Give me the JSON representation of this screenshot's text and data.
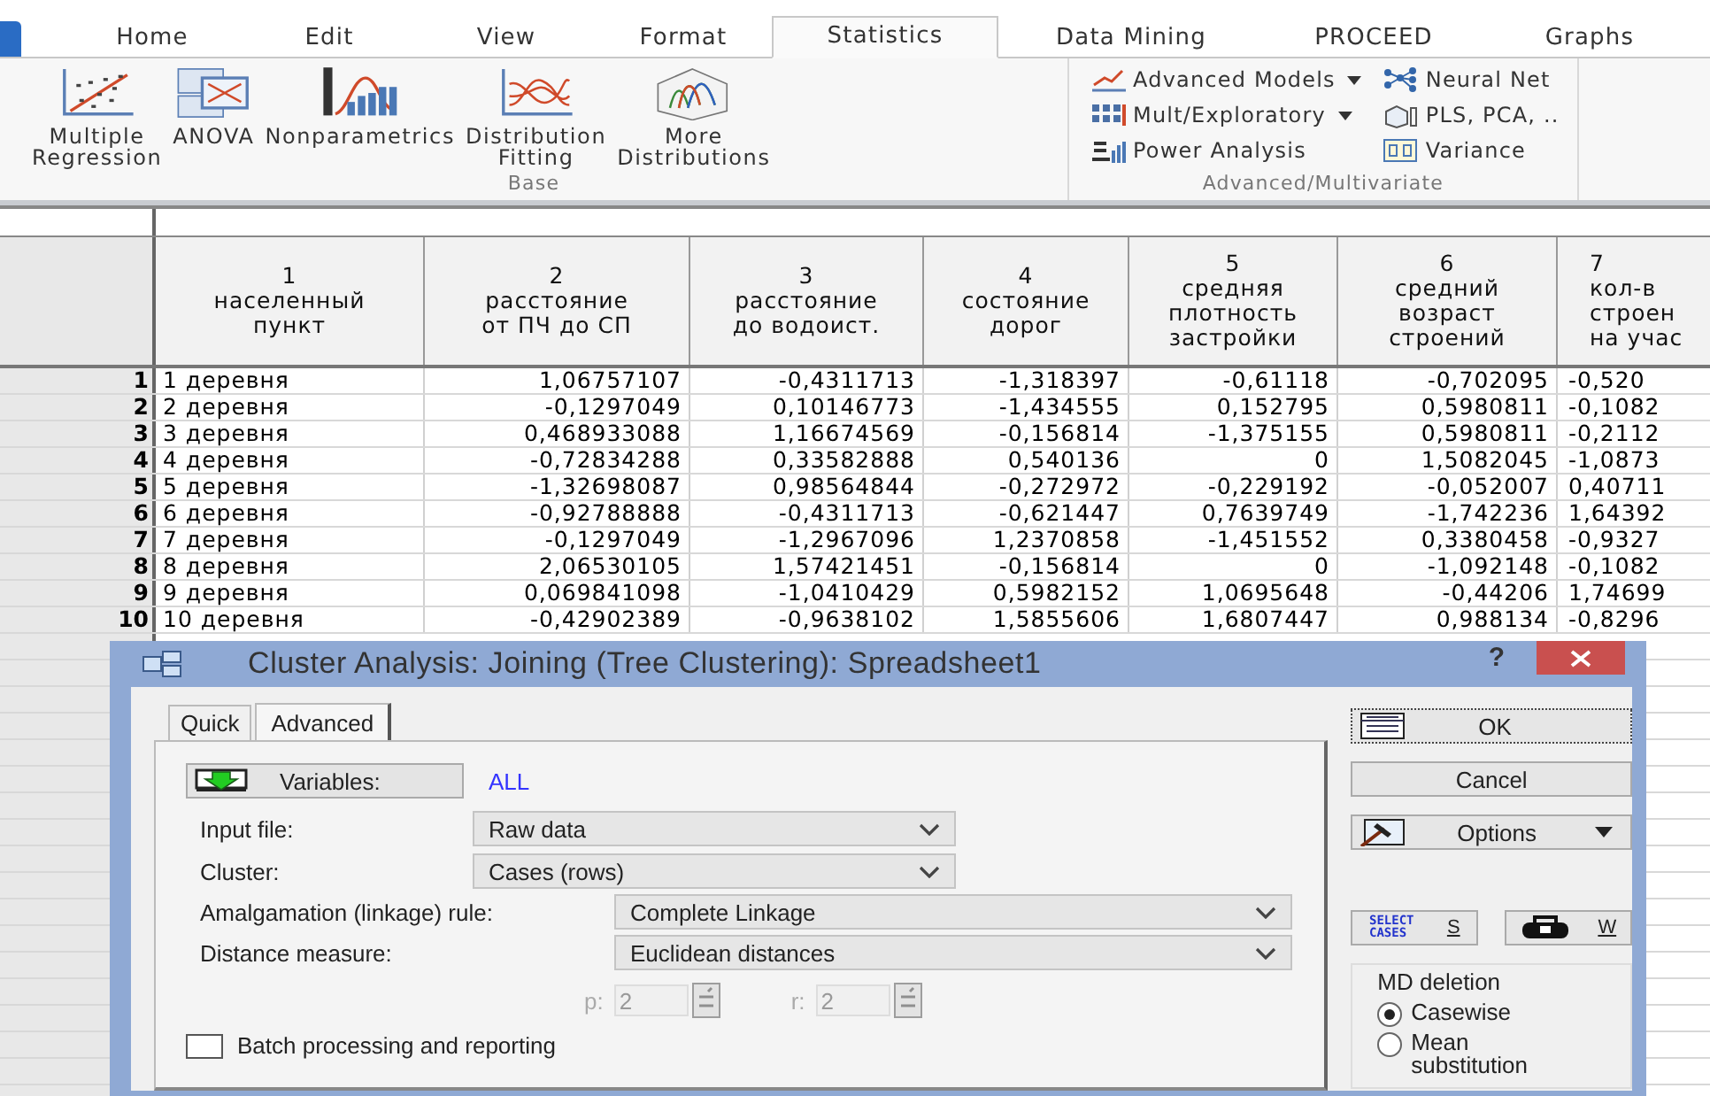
{
  "ribbon": {
    "tabs": [
      {
        "label": "Home",
        "selected": false
      },
      {
        "label": "Edit",
        "selected": false
      },
      {
        "label": "View",
        "selected": false
      },
      {
        "label": "Format",
        "selected": false
      },
      {
        "label": "Statistics",
        "selected": true
      },
      {
        "label": "Data Mining",
        "selected": false
      },
      {
        "label": "PROCEED",
        "selected": false
      },
      {
        "label": "Graphs",
        "selected": false
      }
    ],
    "groups": [
      {
        "label": "Base",
        "kind": "large",
        "items": [
          {
            "label": "Multiple\nRegression"
          },
          {
            "label": "ANOVA"
          },
          {
            "label": "Nonparametrics"
          },
          {
            "label": "Distribution\nFitting"
          },
          {
            "label": "More\nDistributions"
          }
        ]
      },
      {
        "label": "Advanced/Multivariate",
        "kind": "small",
        "items": [
          {
            "label": "Advanced Models",
            "has_menu": true
          },
          {
            "label": "Mult/Exploratory",
            "has_menu": true
          },
          {
            "label": "Power Analysis",
            "has_menu": false
          },
          {
            "label": "Neural Net",
            "has_menu": false
          },
          {
            "label": "PLS, PCA, ..",
            "has_menu": false
          },
          {
            "label": "Variance",
            "has_menu": false
          }
        ]
      }
    ]
  },
  "spreadsheet": {
    "columns": [
      {
        "number": "1",
        "name": "населенный\nпункт"
      },
      {
        "number": "2",
        "name": "расстояние\nот ПЧ до СП"
      },
      {
        "number": "3",
        "name": "расстояние\nдо водоист."
      },
      {
        "number": "4",
        "name": "состояние\nдорог"
      },
      {
        "number": "5",
        "name": "средняя\nплотность\nзастройки"
      },
      {
        "number": "6",
        "name": "средний\nвозраст\nстроений"
      },
      {
        "number": "7",
        "name": "кол-в\nстроен\nна учас"
      }
    ],
    "rows": [
      {
        "number": "1",
        "cells": [
          "1 деревня",
          "1,06757107",
          "-0,4311713",
          "-1,318397",
          "-0,61118",
          "-0,702095",
          "-0,520"
        ]
      },
      {
        "number": "2",
        "cells": [
          "2 деревня",
          "-0,1297049",
          "0,10146773",
          "-1,434555",
          "0,152795",
          "0,5980811",
          "-0,1082"
        ]
      },
      {
        "number": "3",
        "cells": [
          "3 деревня",
          "0,468933088",
          "1,16674569",
          "-0,156814",
          "-1,375155",
          "0,5980811",
          "-0,2112"
        ]
      },
      {
        "number": "4",
        "cells": [
          "4 деревня",
          "-0,72834288",
          "0,33582888",
          "0,540136",
          "0",
          "1,5082045",
          "-1,0873"
        ]
      },
      {
        "number": "5",
        "cells": [
          "5 деревня",
          "-1,32698087",
          "0,98564844",
          "-0,272972",
          "-0,229192",
          "-0,052007",
          "0,40711"
        ]
      },
      {
        "number": "6",
        "cells": [
          "6 деревня",
          "-0,92788888",
          "-0,4311713",
          "-0,621447",
          "0,7639749",
          "-1,742236",
          "1,64392"
        ]
      },
      {
        "number": "7",
        "cells": [
          "7 деревня",
          "-0,1297049",
          "-1,2967096",
          "1,2370858",
          "-1,451552",
          "0,3380458",
          "-0,9327"
        ]
      },
      {
        "number": "8",
        "cells": [
          "8 деревня",
          "2,06530105",
          "1,57421451",
          "-0,156814",
          "0",
          "-1,092148",
          "-0,1082"
        ]
      },
      {
        "number": "9",
        "cells": [
          "9 деревня",
          "0,069841098",
          "-1,0410429",
          "0,5982152",
          "1,0695648",
          "-0,44206",
          "1,74699"
        ]
      },
      {
        "number": "10",
        "cells": [
          "10 деревня",
          "-0,42902389",
          "-0,9638102",
          "1,5855606",
          "1,6807447",
          "0,988134",
          "-0,8296"
        ]
      }
    ]
  },
  "dialog": {
    "title": "Cluster Analysis: Joining (Tree Clustering): Spreadsheet1",
    "help": "?",
    "tabs": [
      {
        "label": "Quick",
        "selected": false
      },
      {
        "label": "Advanced",
        "selected": true
      }
    ],
    "variables": {
      "label": "Variables:",
      "value": "ALL"
    },
    "fields": [
      {
        "label": "Input file:",
        "value": "Raw data"
      },
      {
        "label": "Cluster:",
        "value": "Cases (rows)"
      },
      {
        "label": "Amalgamation (linkage) rule:",
        "value": "Complete Linkage"
      },
      {
        "label": "Distance measure:",
        "value": "Euclidean distances"
      }
    ],
    "params": [
      {
        "label": "p:",
        "value": "2",
        "disabled": true
      },
      {
        "label": "r:",
        "value": "2",
        "disabled": true
      }
    ],
    "batch": {
      "label": "Batch processing and reporting",
      "checked": false
    },
    "buttons": [
      {
        "label": "OK",
        "kind": "ok"
      },
      {
        "label": "Cancel",
        "kind": "plain"
      },
      {
        "label": "Options",
        "kind": "menu"
      }
    ],
    "select_cases": {
      "caption": "SELECT\nCASES",
      "key": "S"
    },
    "weight": {
      "key": "W"
    },
    "md_deletion": {
      "title": "MD deletion",
      "options": [
        {
          "label": "Casewise",
          "selected": true
        },
        {
          "label": "Mean substitution",
          "selected": false
        }
      ]
    }
  }
}
